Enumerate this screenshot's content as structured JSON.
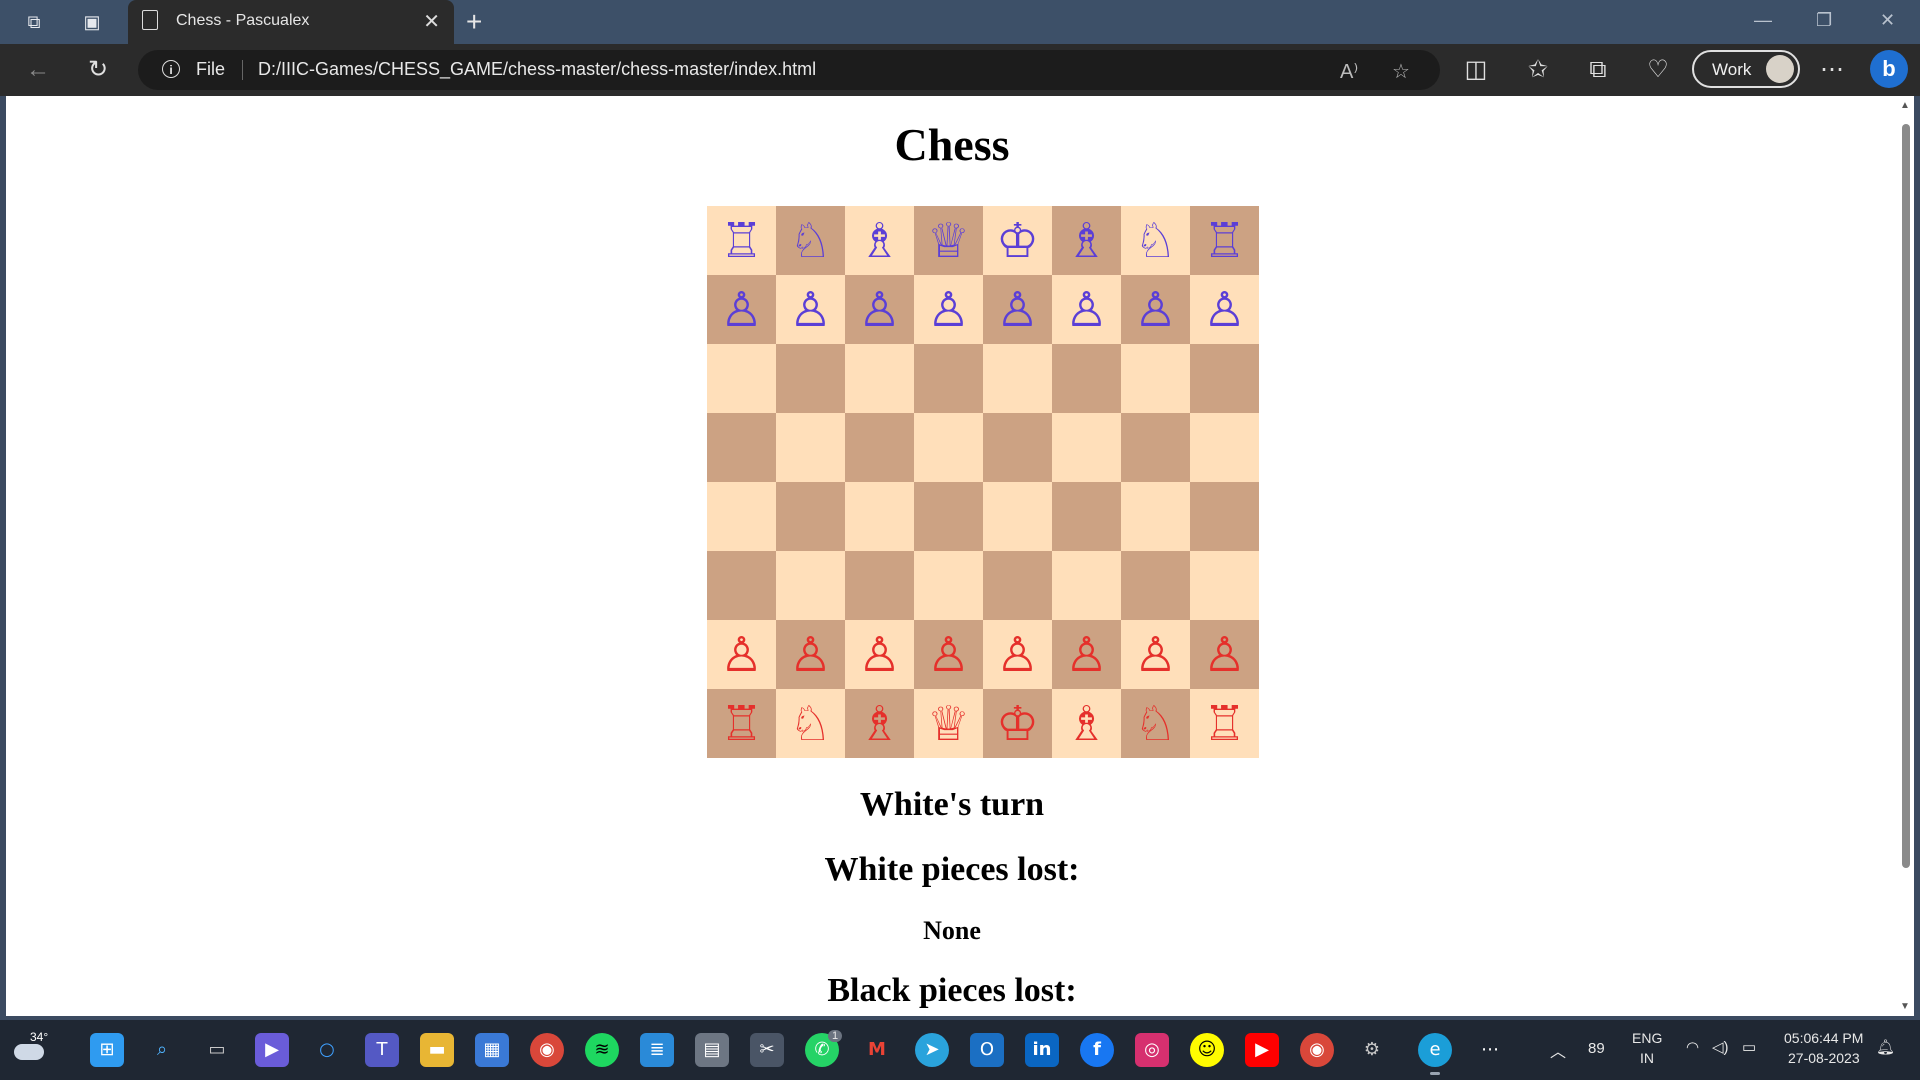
{
  "browser": {
    "tab_title": "Chess - Pascualex",
    "address_scheme": "File",
    "url": "D:/IIIC-Games/CHESS_GAME/chess-master/chess-master/index.html",
    "profile_label": "Work",
    "accent": "#1f6fd1"
  },
  "page": {
    "heading": "Chess",
    "turn_text": "White's turn",
    "white_lost_label": "White pieces lost:",
    "white_lost_value": "None",
    "black_lost_label": "Black pieces lost:",
    "light_square_color": "#ffdfba",
    "dark_square_color": "#cca283",
    "top_piece_color": "#5b3fd6",
    "bottom_piece_color": "#e5302b",
    "board": [
      [
        "♖",
        "♘",
        "♗",
        "♕",
        "♔",
        "♗",
        "♘",
        "♖"
      ],
      [
        "♙",
        "♙",
        "♙",
        "♙",
        "♙",
        "♙",
        "♙",
        "♙"
      ],
      [
        "",
        "",
        "",
        "",
        "",
        "",
        "",
        ""
      ],
      [
        "",
        "",
        "",
        "",
        "",
        "",
        "",
        ""
      ],
      [
        "",
        "",
        "",
        "",
        "",
        "",
        "",
        ""
      ],
      [
        "",
        "",
        "",
        "",
        "",
        "",
        "",
        ""
      ],
      [
        "♙",
        "♙",
        "♙",
        "♙",
        "♙",
        "♙",
        "♙",
        "♙"
      ],
      [
        "♖",
        "♘",
        "♗",
        "♕",
        "♔",
        "♗",
        "♘",
        "♖"
      ]
    ]
  },
  "taskbar": {
    "weather_temp": "34°",
    "whatsapp_badge": "1",
    "tray_count": "89",
    "lang_top": "ENG",
    "lang_bottom": "IN",
    "time": "05:06:44 PM",
    "date": "27-08-2023"
  }
}
